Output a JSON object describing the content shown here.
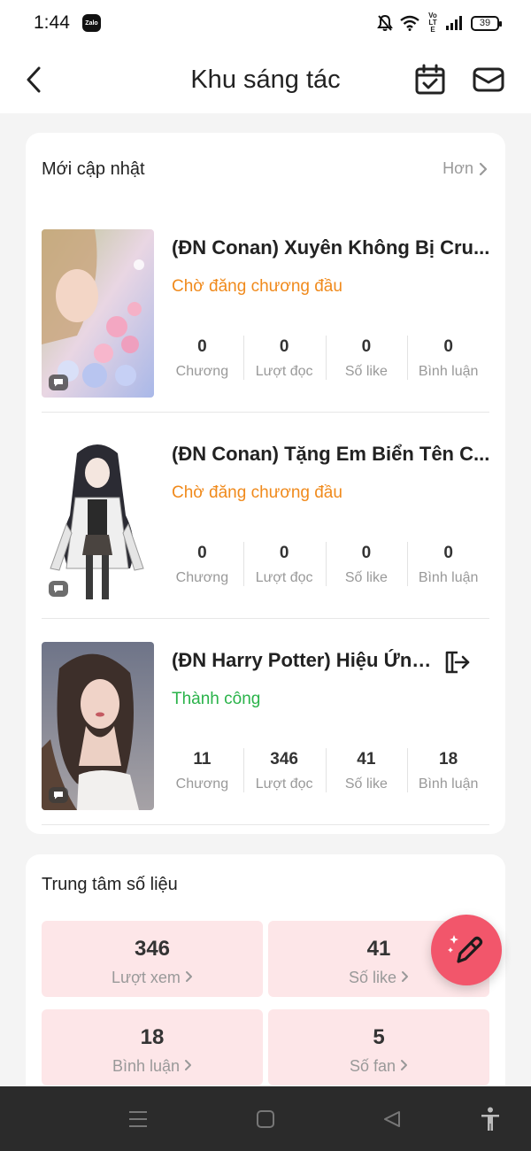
{
  "status_bar": {
    "time": "1:44",
    "app_badge": "Zalo",
    "network": "Vo LTE",
    "battery": "39"
  },
  "header": {
    "title": "Khu sáng tác"
  },
  "recent": {
    "title": "Mới cập nhật",
    "more": "Hơn",
    "stories": [
      {
        "title": "(ĐN Conan) Xuyên Không Bị Cru...",
        "status": "Chờ đăng chương đầu",
        "status_color": "#f08a1c",
        "stats": [
          {
            "value": "0",
            "label": "Chương"
          },
          {
            "value": "0",
            "label": "Lượt đọc"
          },
          {
            "value": "0",
            "label": "Số like"
          },
          {
            "value": "0",
            "label": "Bình luận"
          }
        ]
      },
      {
        "title": "(ĐN Conan) Tặng Em Biển Tên C...",
        "status": "Chờ đăng chương đầu",
        "status_color": "#f08a1c",
        "stats": [
          {
            "value": "0",
            "label": "Chương"
          },
          {
            "value": "0",
            "label": "Lượt đọc"
          },
          {
            "value": "0",
            "label": "Số like"
          },
          {
            "value": "0",
            "label": "Bình luận"
          }
        ]
      },
      {
        "title": "(ĐN Harry Potter) Hiệu Ứng...",
        "status": "Thành công",
        "status_color": "#2ab34a",
        "stats": [
          {
            "value": "11",
            "label": "Chương"
          },
          {
            "value": "346",
            "label": "Lượt đọc"
          },
          {
            "value": "41",
            "label": "Số like"
          },
          {
            "value": "18",
            "label": "Bình luận"
          }
        ]
      }
    ]
  },
  "data_center": {
    "title": "Trung tâm số liệu",
    "tiles": [
      {
        "value": "346",
        "label": "Lượt xem"
      },
      {
        "value": "41",
        "label": "Số like"
      },
      {
        "value": "18",
        "label": "Bình luận"
      },
      {
        "value": "5",
        "label": "Số fan"
      }
    ]
  },
  "icons": {
    "back": "back-arrow-icon",
    "calendar": "calendar-check-icon",
    "mail": "mail-icon",
    "fab": "pencil-sparkle-icon",
    "nav": [
      "menu-icon",
      "home-square-icon",
      "back-triangle-icon",
      "accessibility-icon"
    ]
  },
  "colors": {
    "accent": "#f2566b",
    "tile_bg": "#fde6e8",
    "pending": "#f08a1c",
    "success": "#2ab34a"
  }
}
